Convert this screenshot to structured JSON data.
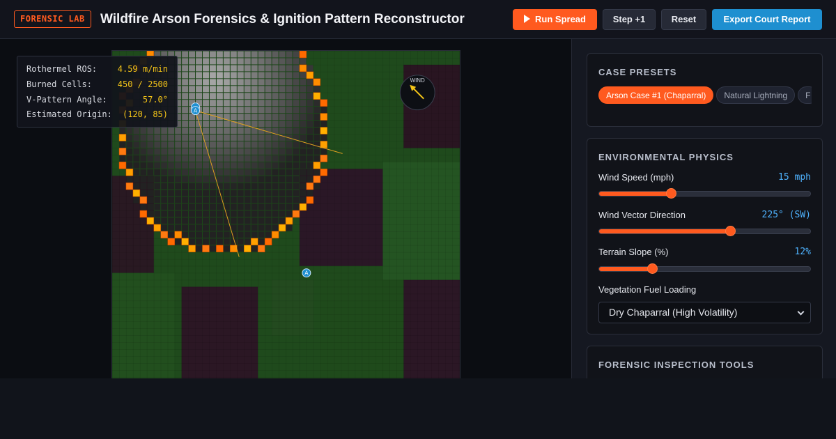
{
  "header": {
    "badge": "FORENSIC LAB",
    "title": "Wildfire Arson Forensics & Ignition Pattern Reconstructor",
    "buttons": {
      "run": "Run Spread",
      "step": "Step +1",
      "reset": "Reset",
      "export": "Export Court Report"
    }
  },
  "stats": [
    {
      "label": "Rothermel ROS:",
      "value": "4.59 m/min"
    },
    {
      "label": "Burned Cells:",
      "value": "450 / 2500"
    },
    {
      "label": "V-Pattern Angle:",
      "value": "57.0°"
    },
    {
      "label": "Estimated Origin:",
      "value": "(120, 85)"
    }
  ],
  "map": {
    "compass_label": "WIND",
    "marker_glyph": "A"
  },
  "presets": {
    "title": "CASE PRESETS",
    "items": [
      {
        "label": "Arson Case #1 (Chaparral)",
        "active": true
      },
      {
        "label": "Natural Lightning",
        "active": false
      },
      {
        "label": "F",
        "active": false
      }
    ]
  },
  "physics": {
    "title": "ENVIRONMENTAL PHYSICS",
    "wind_speed": {
      "label": "Wind Speed (mph)",
      "value": "15 mph",
      "fraction": 0.34
    },
    "wind_direction": {
      "label": "Wind Vector Direction",
      "value": "225° (SW)",
      "fraction": 0.62
    },
    "slope": {
      "label": "Terrain Slope (%)",
      "value": "12%",
      "fraction": 0.25
    },
    "fuel": {
      "label": "Vegetation Fuel Loading",
      "selected": "Dry Chaparral (High Volatility)"
    }
  },
  "tools": {
    "title": "FORENSIC INSPECTION TOOLS"
  },
  "colors": {
    "accent": "#ff5a1f",
    "info": "#4fb3ff",
    "stat_value": "#f5c518",
    "export": "#1e8fd0"
  }
}
